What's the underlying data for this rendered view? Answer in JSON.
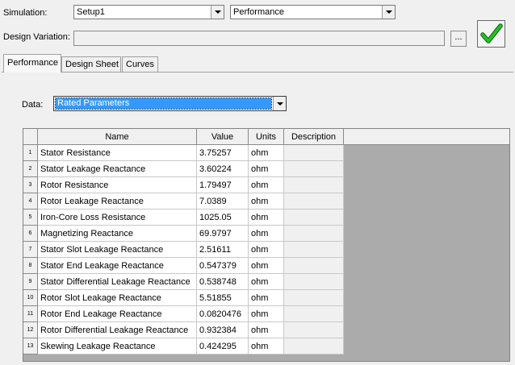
{
  "form": {
    "simulation_label": "Simulation:",
    "simulation_setup": "Setup1",
    "simulation_type": "Performance",
    "design_variation_label": "Design Variation:",
    "design_variation_value": "",
    "browse_label": "..."
  },
  "tabs": [
    {
      "label": "Performance",
      "active": true
    },
    {
      "label": "Design Sheet",
      "active": false
    },
    {
      "label": "Curves",
      "active": false
    }
  ],
  "data_selector": {
    "label": "Data:",
    "value": "Rated Parameters"
  },
  "table": {
    "columns": [
      "Name",
      "Value",
      "Units",
      "Description"
    ],
    "rows": [
      {
        "n": "1",
        "name": "Stator Resistance",
        "value": "3.75257",
        "units": "ohm",
        "description": ""
      },
      {
        "n": "2",
        "name": "Stator Leakage Reactance",
        "value": "3.60224",
        "units": "ohm",
        "description": ""
      },
      {
        "n": "3",
        "name": "Rotor Resistance",
        "value": "1.79497",
        "units": "ohm",
        "description": ""
      },
      {
        "n": "4",
        "name": "Rotor Leakage Reactance",
        "value": "7.0389",
        "units": "ohm",
        "description": ""
      },
      {
        "n": "5",
        "name": "Iron-Core Loss Resistance",
        "value": "1025.05",
        "units": "ohm",
        "description": ""
      },
      {
        "n": "6",
        "name": "Magnetizing Reactance",
        "value": "69.9797",
        "units": "ohm",
        "description": ""
      },
      {
        "n": "7",
        "name": "Stator Slot Leakage Reactance",
        "value": "2.51611",
        "units": "ohm",
        "description": ""
      },
      {
        "n": "8",
        "name": "Stator End Leakage Reactance",
        "value": "0.547379",
        "units": "ohm",
        "description": ""
      },
      {
        "n": "9",
        "name": "Stator Differential Leakage Reactance",
        "value": "0.538748",
        "units": "ohm",
        "description": ""
      },
      {
        "n": "10",
        "name": "Rotor Slot Leakage Reactance",
        "value": "5.51855",
        "units": "ohm",
        "description": ""
      },
      {
        "n": "11",
        "name": "Rotor End Leakage Reactance",
        "value": "0.0820476",
        "units": "ohm",
        "description": ""
      },
      {
        "n": "12",
        "name": "Rotor Differential Leakage Reactance",
        "value": "0.932384",
        "units": "ohm",
        "description": ""
      },
      {
        "n": "13",
        "name": "Skewing Leakage Reactance",
        "value": "0.424295",
        "units": "ohm",
        "description": ""
      }
    ]
  },
  "colors": {
    "selection": "#3399ff",
    "check": "#1cb81c"
  }
}
